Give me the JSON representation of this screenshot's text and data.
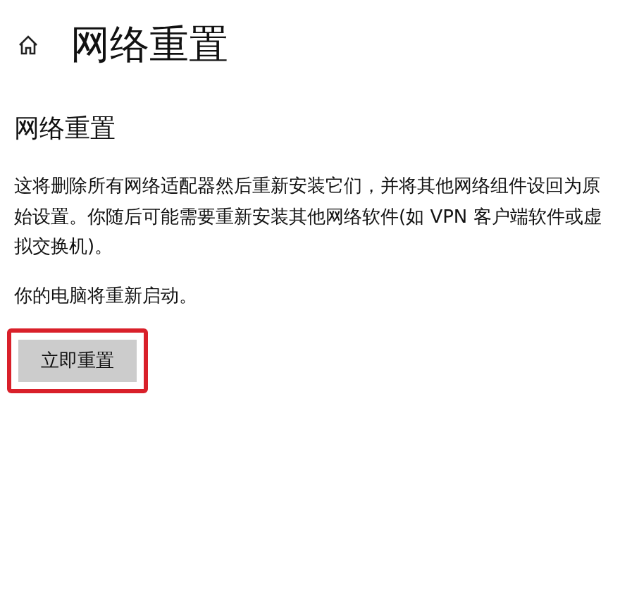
{
  "page": {
    "title": "网络重置"
  },
  "section": {
    "heading": "网络重置",
    "description": "这将删除所有网络适配器然后重新安装它们，并将其他网络组件设回为原始设置。你随后可能需要重新安装其他网络软件(如 VPN 客户端软件或虚拟交换机)。",
    "note": "你的电脑将重新启动。"
  },
  "button": {
    "label": "立即重置",
    "highlighted": true
  }
}
